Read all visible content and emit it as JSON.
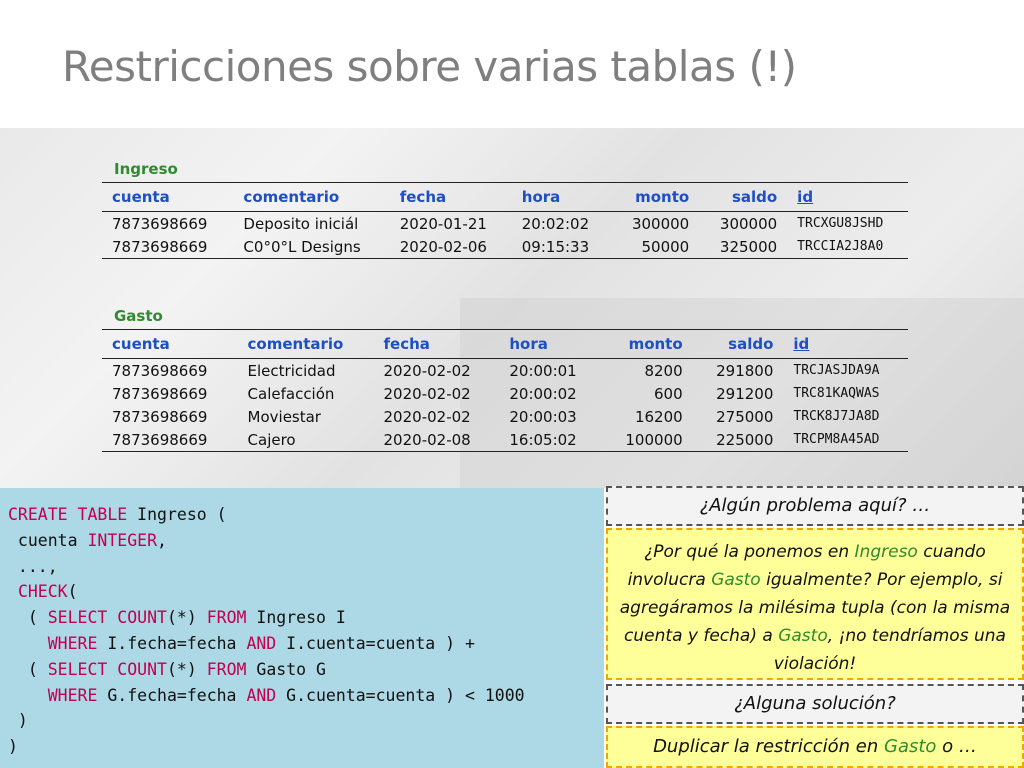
{
  "slide": {
    "title": "Restricciones sobre varias tablas (!)"
  },
  "ingreso": {
    "name": "Ingreso",
    "headers": [
      "cuenta",
      "comentario",
      "fecha",
      "hora",
      "monto",
      "saldo",
      "id"
    ],
    "rows": [
      [
        "7873698669",
        "Deposito iniciál",
        "2020-01-21",
        "20:02:02",
        "300000",
        "300000",
        "TRCXGU8JSHD"
      ],
      [
        "7873698669",
        "C0°0°L Designs",
        "2020-02-06",
        "09:15:33",
        "50000",
        "325000",
        "TRCCIA2J8A0"
      ]
    ]
  },
  "gasto": {
    "name": "Gasto",
    "headers": [
      "cuenta",
      "comentario",
      "fecha",
      "hora",
      "monto",
      "saldo",
      "id"
    ],
    "rows": [
      [
        "7873698669",
        "Electricidad",
        "2020-02-02",
        "20:00:01",
        "8200",
        "291800",
        "TRCJASJDA9A"
      ],
      [
        "7873698669",
        "Calefacción",
        "2020-02-02",
        "20:00:02",
        "600",
        "291200",
        "TRC81KAQWAS"
      ],
      [
        "7873698669",
        "Moviestar",
        "2020-02-02",
        "20:00:03",
        "16200",
        "275000",
        "TRCK8J7JA8D"
      ],
      [
        "7873698669",
        "Cajero",
        "2020-02-08",
        "16:05:02",
        "100000",
        "225000",
        "TRCPM8A45AD"
      ]
    ]
  },
  "code": {
    "l1a": "CREATE TABLE",
    "l1b": " Ingreso (",
    "l2a": " cuenta ",
    "l2b": "INTEGER",
    "l2c": ",",
    "l3": " ...,",
    "l4a": " ",
    "l4b": "CHECK",
    "l4c": "(",
    "l5a": "  ( ",
    "l5b": "SELECT",
    "l5c": " ",
    "l5d": "COUNT",
    "l5e": "(*) ",
    "l5f": "FROM",
    "l5g": " Ingreso I",
    "l6a": "    ",
    "l6b": "WHERE",
    "l6c": " I.fecha=fecha ",
    "l6d": "AND",
    "l6e": " I.cuenta=cuenta ) +",
    "l7a": "  ( ",
    "l7b": "SELECT",
    "l7c": " ",
    "l7d": "COUNT",
    "l7e": "(*) ",
    "l7f": "FROM",
    "l7g": " Gasto G",
    "l8a": "    ",
    "l8b": "WHERE",
    "l8c": " G.fecha=fecha ",
    "l8d": "AND",
    "l8e": " G.cuenta=cuenta ) < 1000",
    "l9": " )",
    "l10": ")"
  },
  "boxes": {
    "q1": "¿Algún problema aquí? …",
    "q2": {
      "p1": "¿Por qué la ponemos en ",
      "g1": "Ingreso",
      "p2": " cuando involucra ",
      "g2": "Gasto",
      "p3": " igualmente? Por ejemplo, si agregáramos la milésima tupla (con la misma cuenta y fecha) a ",
      "g3": "Gasto",
      "p4": ", ¡no tendríamos una violación!"
    },
    "q3": "¿Alguna solución?",
    "q4": {
      "p1": "Duplicar la restricción en ",
      "g1": "Gasto",
      "p2": " o …"
    }
  },
  "colors": {
    "keyword": "#c00050",
    "table_name": "#2e8b2e",
    "header": "#1f4fc4",
    "code_bg": "#add8e6",
    "note_bg": "#ffff99"
  }
}
